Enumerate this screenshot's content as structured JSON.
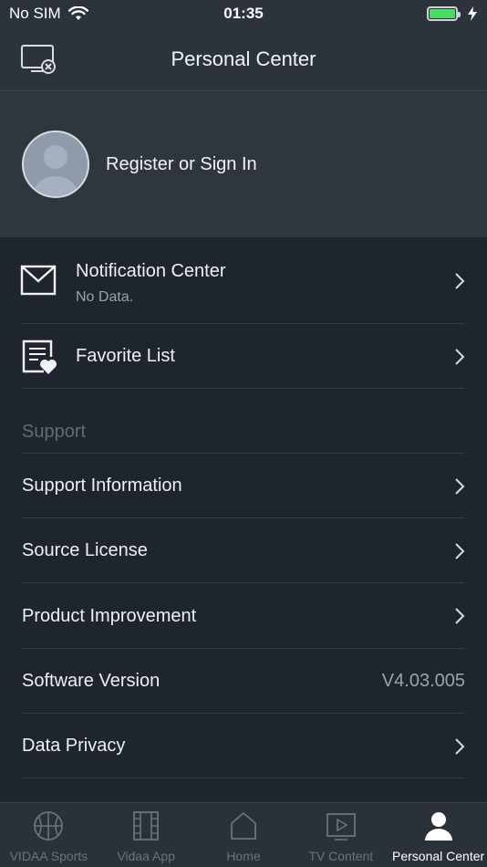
{
  "status_bar": {
    "carrier": "No SIM",
    "time": "01:35"
  },
  "nav": {
    "title": "Personal Center",
    "left_icon": "screen-disconnect-icon"
  },
  "profile": {
    "signin_label": "Register or Sign In",
    "avatar_icon": "user-avatar-icon"
  },
  "menu": {
    "notification": {
      "label": "Notification Center",
      "sub": "No Data.",
      "icon": "envelope-icon"
    },
    "favorite": {
      "label": "Favorite List",
      "icon": "favorite-list-icon"
    }
  },
  "support": {
    "header": "Support",
    "items": [
      {
        "label": "Support Information"
      },
      {
        "label": "Source License"
      },
      {
        "label": "Product Improvement"
      },
      {
        "label": "Software Version",
        "value": "V4.03.005"
      },
      {
        "label": "Data Privacy"
      }
    ]
  },
  "tabs": [
    {
      "label": "VIDAA Sports",
      "icon": "basketball-icon"
    },
    {
      "label": "Vidaa App",
      "icon": "film-icon"
    },
    {
      "label": "Home",
      "icon": "home-icon"
    },
    {
      "label": "TV Content",
      "icon": "play-icon"
    },
    {
      "label": "Personal Center",
      "icon": "person-icon",
      "active": true
    }
  ],
  "colors": {
    "background": "#1f252c",
    "header": "#2c333b",
    "profile_bg": "#2f363e",
    "battery": "#4cd964",
    "muted_text": "#9aa3ad"
  }
}
